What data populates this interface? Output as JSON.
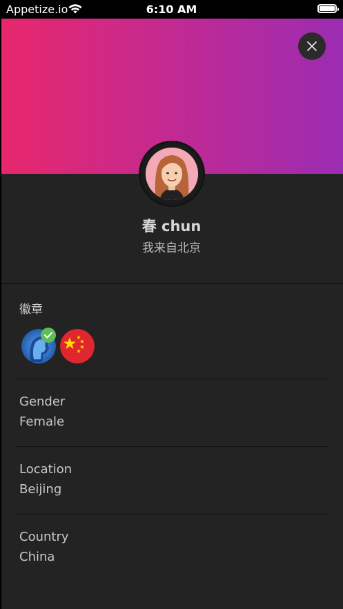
{
  "status_bar": {
    "carrier": "Appetize.io",
    "time": "6:10 AM"
  },
  "profile": {
    "name": "春 chun",
    "subtitle": "我来自北京"
  },
  "badges": {
    "title": "徽章",
    "items": [
      {
        "icon": "verified-profile-badge-icon",
        "color": "#3a7fd5"
      },
      {
        "icon": "china-flag-badge-icon",
        "color": "#e0262e"
      }
    ]
  },
  "details": [
    {
      "label": "Gender",
      "value": "Female"
    },
    {
      "label": "Location",
      "value": "Beijing"
    },
    {
      "label": "Country",
      "value": "China"
    }
  ],
  "colors": {
    "gradient_start": "#e8276c",
    "gradient_end": "#9b2cb2",
    "panel_bg": "#232323"
  }
}
